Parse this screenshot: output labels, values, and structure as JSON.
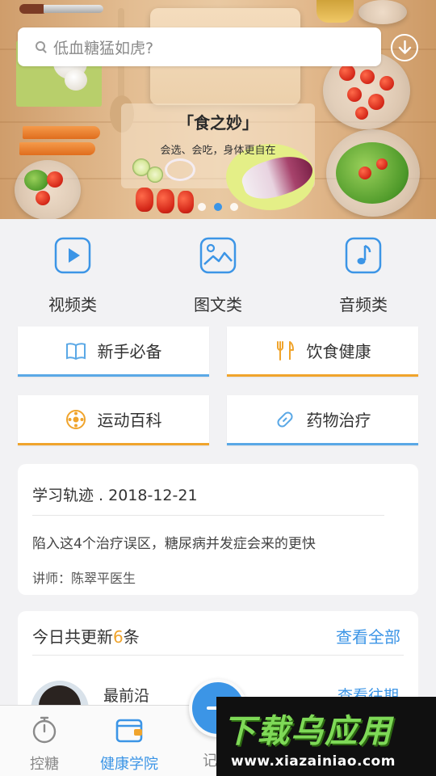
{
  "banner": {
    "search_placeholder": "低血糖猛如虎?",
    "slogan_title": "「食之妙」",
    "slogan_subtitle": "会选、会吃，身体更自在",
    "dots": 3,
    "active_dot": 2
  },
  "categories": [
    {
      "label": "视频类",
      "icon": "video-play-icon"
    },
    {
      "label": "图文类",
      "icon": "image-icon"
    },
    {
      "label": "音频类",
      "icon": "music-note-icon"
    }
  ],
  "topics": [
    {
      "label": "新手必备",
      "icon": "book-icon",
      "accent": "blue"
    },
    {
      "label": "饮食健康",
      "icon": "fork-knife-icon",
      "accent": "orange"
    },
    {
      "label": "运动百科",
      "icon": "ball-icon",
      "accent": "orange"
    },
    {
      "label": "药物治疗",
      "icon": "pill-icon",
      "accent": "blue"
    }
  ],
  "study": {
    "title": "学习轨迹 . 2018-12-21",
    "course": "陷入这4个治疗误区，糖尿病并发症会来的更快",
    "teacher": "讲师：陈翠平医生"
  },
  "updates": {
    "title_prefix": "今日共更新",
    "count": "6",
    "title_suffix": "条",
    "view_all": "查看全部",
    "item_name": "最前沿",
    "view_past": "查看往期"
  },
  "tabs": [
    {
      "label": "控糖",
      "icon": "stopwatch-icon",
      "active": false
    },
    {
      "label": "健康学院",
      "icon": "wallet-icon",
      "active": true
    },
    {
      "label": "记",
      "icon": "add-icon",
      "active": false
    }
  ],
  "watermark": {
    "title": "下载乌应用",
    "url": "www.xiazainiao.com"
  },
  "colors": {
    "accent_blue": "#3c95e6",
    "accent_orange": "#f0a42c",
    "background": "#f2f2f4"
  }
}
